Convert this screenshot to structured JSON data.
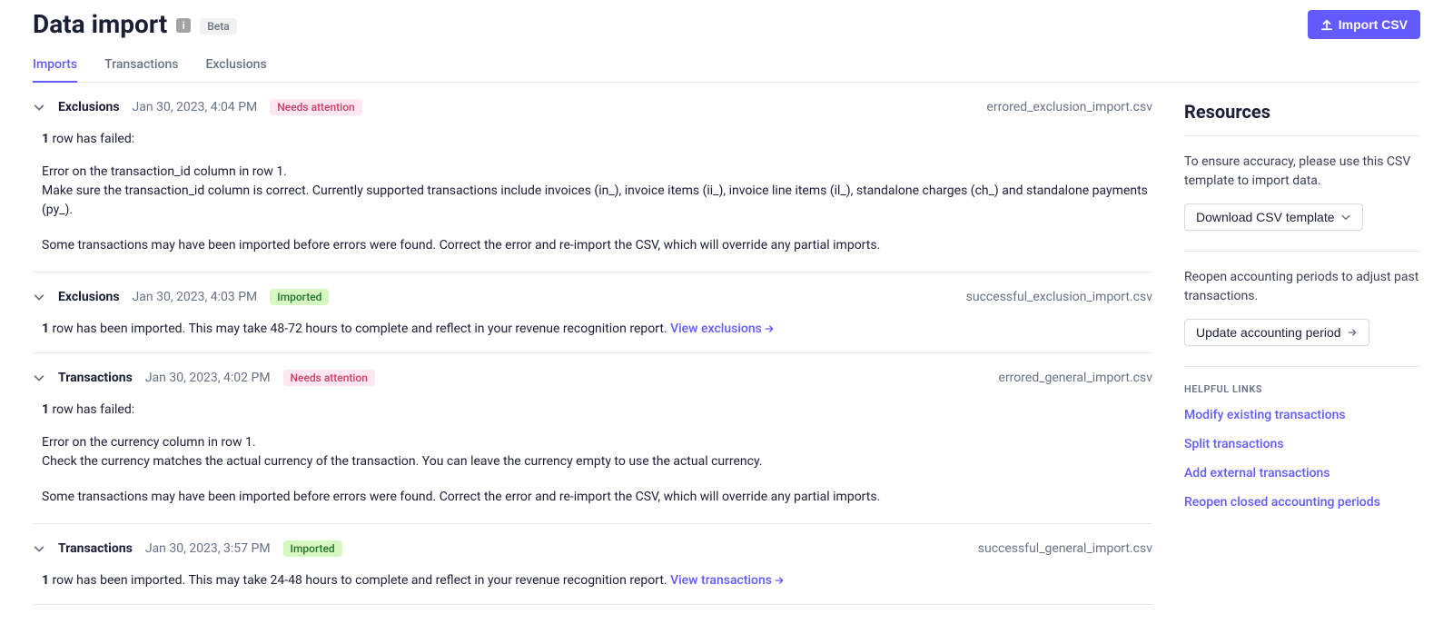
{
  "header": {
    "title": "Data import",
    "badge": "Beta",
    "import_btn": "Import CSV"
  },
  "tabs": [
    "Imports",
    "Transactions",
    "Exclusions"
  ],
  "active_tab": 0,
  "imports": [
    {
      "type": "Exclusions",
      "timestamp": "Jan 30, 2023, 4:04 PM",
      "status": "Needs attention",
      "status_kind": "needs",
      "file": "errored_exclusion_import.csv",
      "failed_count": "1",
      "failed_suffix": " row has failed:",
      "error": "Error on the transaction_id column in row 1.\nMake sure the transaction_id column is correct. Currently supported transactions include invoices (in_), invoice items (ii_), invoice line items (il_), standalone charges (ch_) and standalone payments (py_).",
      "warning": "Some transactions may have been imported before errors were found. Correct the error and re-import the CSV, which will override any partial imports."
    },
    {
      "type": "Exclusions",
      "timestamp": "Jan 30, 2023, 4:03 PM",
      "status": "Imported",
      "status_kind": "ok",
      "file": "successful_exclusion_import.csv",
      "success_count": "1",
      "success_text": " row has been imported. This may take 48-72 hours to complete and reflect in your revenue recognition report. ",
      "view_link": "View exclusions"
    },
    {
      "type": "Transactions",
      "timestamp": "Jan 30, 2023, 4:02 PM",
      "status": "Needs attention",
      "status_kind": "needs",
      "file": "errored_general_import.csv",
      "failed_count": "1",
      "failed_suffix": " row has failed:",
      "error": "Error on the currency column in row 1.\nCheck the currency matches the actual currency of the transaction. You can leave the currency empty to use the actual currency.",
      "warning": "Some transactions may have been imported before errors were found. Correct the error and re-import the CSV, which will override any partial imports."
    },
    {
      "type": "Transactions",
      "timestamp": "Jan 30, 2023, 3:57 PM",
      "status": "Imported",
      "status_kind": "ok",
      "file": "successful_general_import.csv",
      "success_count": "1",
      "success_text": " row has been imported. This may take 24-48 hours to complete and reflect in your revenue recognition report. ",
      "view_link": "View transactions"
    }
  ],
  "resources": {
    "title": "Resources",
    "template_text": "To ensure accuracy, please use this CSV template to import data.",
    "download_btn": "Download CSV template",
    "reopen_text": "Reopen accounting periods to adjust past transactions.",
    "update_btn": "Update accounting period",
    "helpful_label": "HELPFUL LINKS",
    "links": [
      "Modify existing transactions",
      "Split transactions",
      "Add external transactions",
      "Reopen closed accounting periods"
    ]
  }
}
